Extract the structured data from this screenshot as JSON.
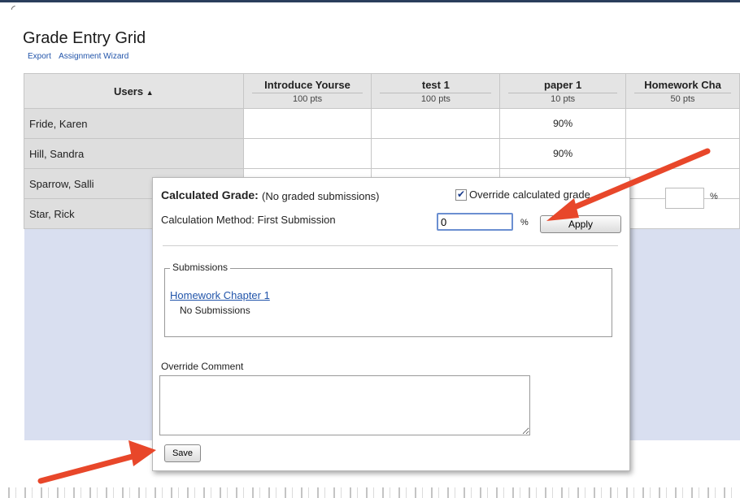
{
  "page": {
    "title": "Grade Entry Grid",
    "links": [
      "Export",
      "Assignment Wizard"
    ]
  },
  "grid": {
    "users_header": "Users",
    "sort_indicator": "▲",
    "columns": [
      {
        "name": "Introduce Yourse",
        "points": "100 pts"
      },
      {
        "name": "test 1",
        "points": "100 pts"
      },
      {
        "name": "paper 1",
        "points": "10 pts"
      },
      {
        "name": "Homework Cha",
        "points": "50 pts"
      }
    ],
    "rows": [
      {
        "name": "Fride, Karen",
        "paper1": "90%"
      },
      {
        "name": "Hill, Sandra",
        "paper1": "90%"
      },
      {
        "name": "Sparrow, Salli",
        "paper1": ""
      },
      {
        "name": "Star, Rick",
        "paper1": ""
      }
    ],
    "override_percent": "%"
  },
  "popup": {
    "calc_label": "Calculated Grade:",
    "calc_value": "(No graded submissions)",
    "override_label": "Override calculated grade",
    "override_checked": true,
    "method_label": "Calculation Method:",
    "method_value": "First Submission",
    "grade_value": "0",
    "percent": "%",
    "apply_label": "Apply",
    "submissions_legend": "Submissions",
    "submission_link": "Homework Chapter 1",
    "no_submissions": "No Submissions",
    "comment_label": "Override Comment",
    "comment_value": "",
    "save_label": "Save"
  },
  "colors": {
    "accent": "#2255aa",
    "arrow": "#e8472a",
    "empty_area": "#d9dff0"
  }
}
